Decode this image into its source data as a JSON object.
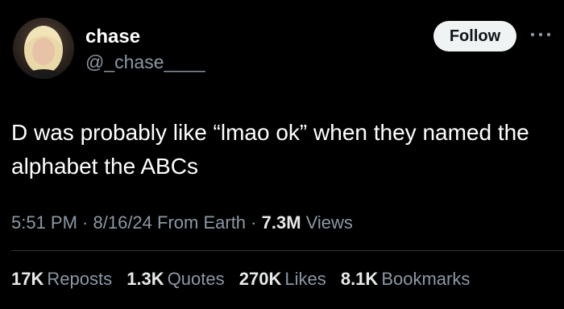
{
  "user": {
    "display_name": "chase",
    "handle": "@_chase____"
  },
  "follow_label": "Follow",
  "tweet": {
    "text": "D was probably like “lmao ok” when they named the alphabet the ABCs"
  },
  "meta": {
    "time": "5:51 PM",
    "sep1": " · ",
    "date": "8/16/24",
    "source": " From Earth",
    "sep2": " · ",
    "views_count": "7.3M",
    "views_label": " Views"
  },
  "stats": [
    {
      "count": "17K",
      "label": "Reposts"
    },
    {
      "count": "1.3K",
      "label": "Quotes"
    },
    {
      "count": "270K",
      "label": "Likes"
    },
    {
      "count": "8.1K",
      "label": "Bookmarks"
    }
  ],
  "icons": {
    "more": "more-options-icon"
  },
  "colors": {
    "background": "#000000",
    "primary_text": "#e7e9ea",
    "secondary_text": "#8b98a5",
    "follow_bg": "#eff3f4"
  }
}
